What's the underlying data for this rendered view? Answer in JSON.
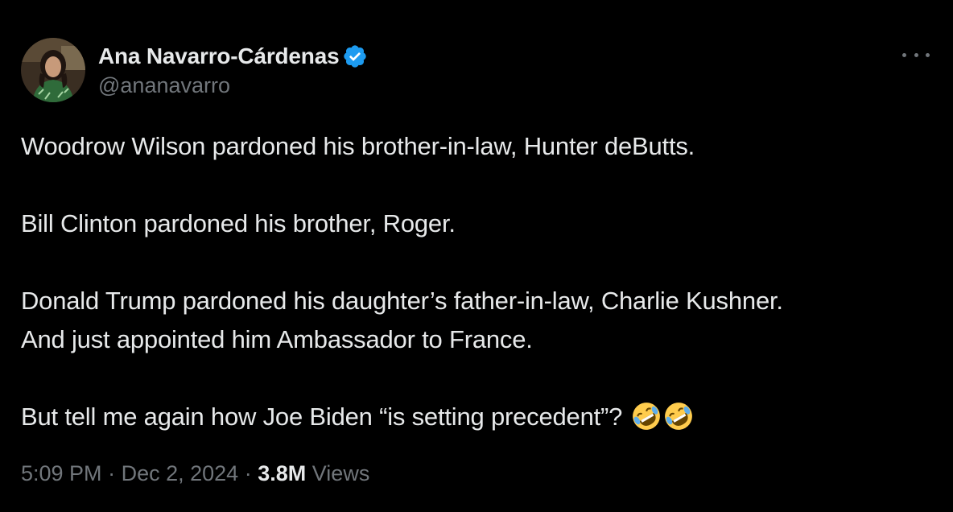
{
  "author": {
    "display_name": "Ana Navarro-Cárdenas",
    "handle": "@ananavarro",
    "verified": true,
    "verified_color": "#1d9bf0"
  },
  "menu_icon": "more-horizontal-icon",
  "tweet": {
    "lines": [
      "Woodrow Wilson pardoned his brother-in-law, Hunter deButts.",
      "Bill Clinton pardoned his brother, Roger.",
      "Donald Trump pardoned his daughter’s father-in-law, Charlie Kushner.",
      "And just appointed him Ambassador to France.",
      "But tell me again how Joe Biden “is setting precedent”?"
    ],
    "trailing_emoji": "rolling-on-floor-laughing-emoji"
  },
  "meta": {
    "time": "5:09 PM",
    "separator": "·",
    "date": "Dec 2, 2024",
    "views_count": "3.8M",
    "views_label": "Views"
  },
  "colors": {
    "background": "#000000",
    "text": "#e7e9ea",
    "secondary": "#71767b"
  }
}
